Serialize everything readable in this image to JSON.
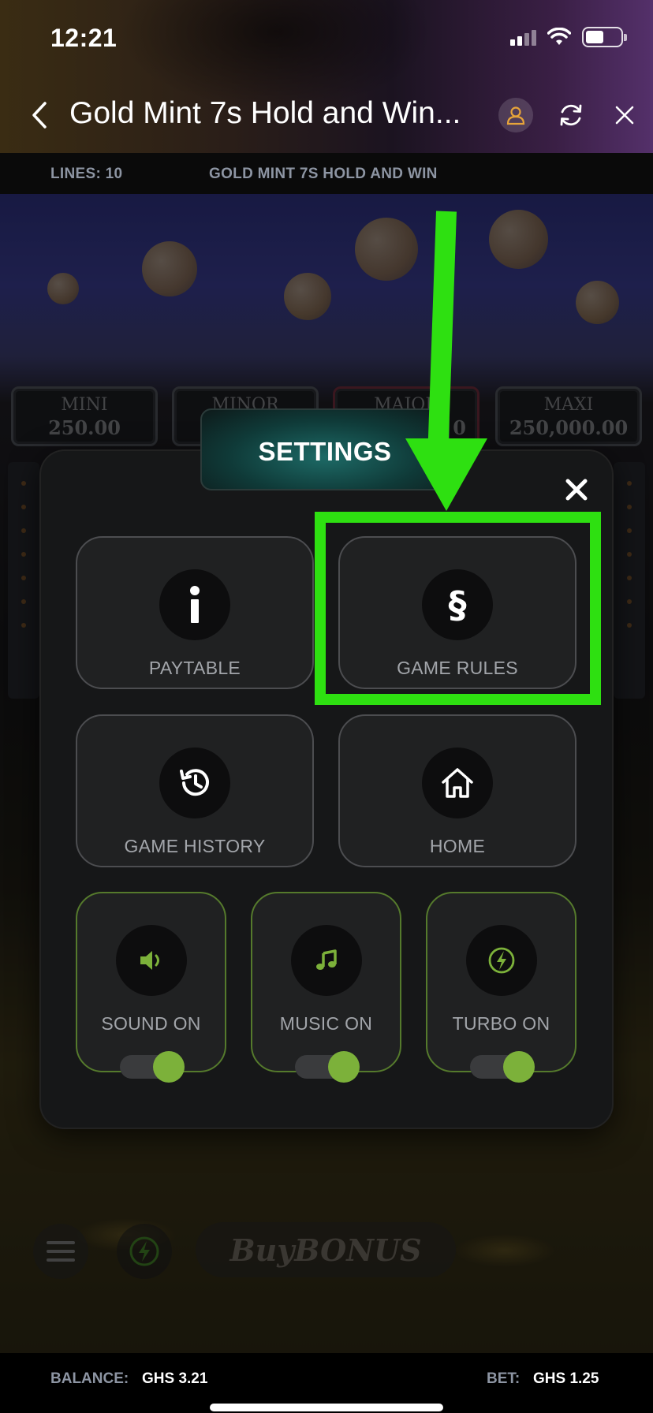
{
  "status_bar": {
    "time": "12:21",
    "icons": [
      "signal-icon",
      "wifi-icon",
      "battery-icon"
    ]
  },
  "header": {
    "title": "Gold Mint 7s Hold and Win...",
    "icons": [
      "back-icon",
      "user-icon",
      "refresh-icon",
      "close-icon"
    ]
  },
  "info_bar": {
    "lines": "LINES: 10",
    "game_name": "GOLD MINT 7S HOLD AND WIN"
  },
  "jackpots": [
    {
      "name": "MINI",
      "value": "250.00"
    },
    {
      "name": "MINOR",
      "value": ""
    },
    {
      "name": "MAJOR",
      "value": "0"
    },
    {
      "name": "MAXI",
      "value": "250,000.00"
    }
  ],
  "settings": {
    "title": "SETTINGS",
    "tiles": [
      {
        "label": "PAYTABLE",
        "icon": "info-icon"
      },
      {
        "label": "GAME RULES",
        "icon": "section-icon"
      },
      {
        "label": "GAME HISTORY",
        "icon": "history-icon"
      },
      {
        "label": "HOME",
        "icon": "home-icon"
      }
    ],
    "toggles": [
      {
        "label": "SOUND ON",
        "icon": "speaker-icon",
        "on": true
      },
      {
        "label": "MUSIC ON",
        "icon": "music-note-icon",
        "on": true
      },
      {
        "label": "TURBO ON",
        "icon": "lightning-icon",
        "on": true
      }
    ]
  },
  "game_controls": {
    "buy_bonus": "BuyBONUS"
  },
  "footer": {
    "balance_label": "BALANCE:",
    "balance_value": "GHS 3.21",
    "bet_label": "BET:",
    "bet_value": "GHS 1.25"
  },
  "colors": {
    "accent_green": "#2ee011",
    "toggle_green": "#7cb13a",
    "label_gray": "#8d95a3"
  }
}
